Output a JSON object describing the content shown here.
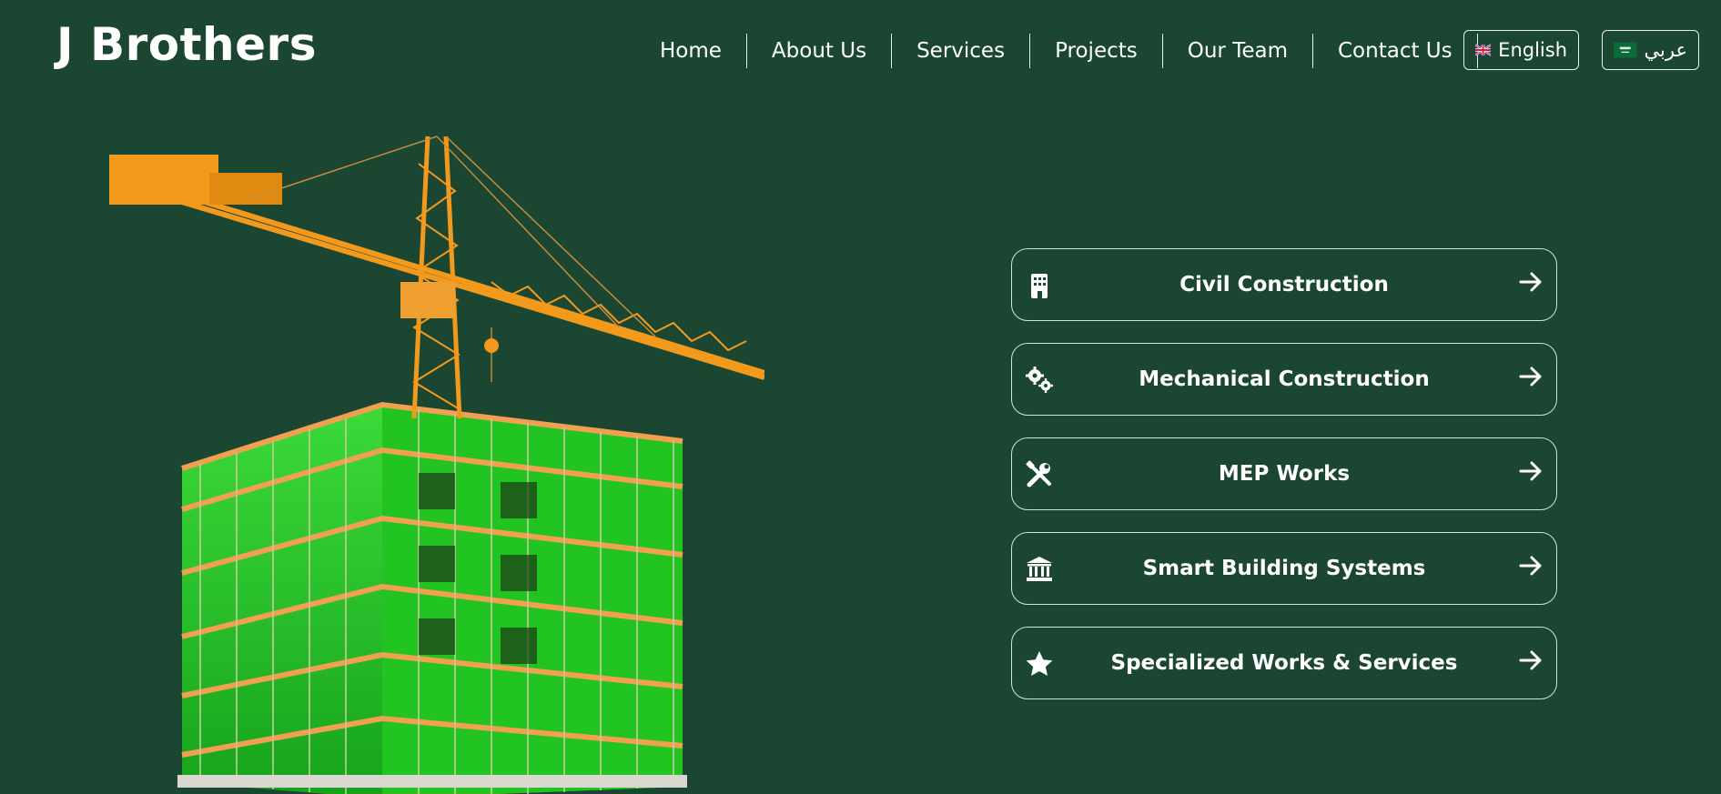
{
  "brand": {
    "name": "J Brothers"
  },
  "nav": {
    "items": [
      {
        "label": "Home"
      },
      {
        "label": "About Us"
      },
      {
        "label": "Services"
      },
      {
        "label": "Projects"
      },
      {
        "label": "Our Team"
      },
      {
        "label": "Contact Us"
      }
    ]
  },
  "language": {
    "english": {
      "label": "English",
      "flag": "uk-flag-icon"
    },
    "arabic": {
      "label": "عربي",
      "flag": "saudi-flag-icon"
    }
  },
  "hero": {
    "image": "crane-building-illustration"
  },
  "services": {
    "items": [
      {
        "label": "Civil Construction",
        "icon": "building-icon"
      },
      {
        "label": "Mechanical Construction",
        "icon": "gears-icon"
      },
      {
        "label": "MEP Works",
        "icon": "tools-icon"
      },
      {
        "label": "Smart Building Systems",
        "icon": "landmark-icon"
      },
      {
        "label": "Specialized Works & Services",
        "icon": "star-icon"
      }
    ]
  },
  "colors": {
    "background": "#1b4632",
    "text": "#ffffff",
    "crane": "#f39a1c",
    "netting": "#2ed32a"
  }
}
